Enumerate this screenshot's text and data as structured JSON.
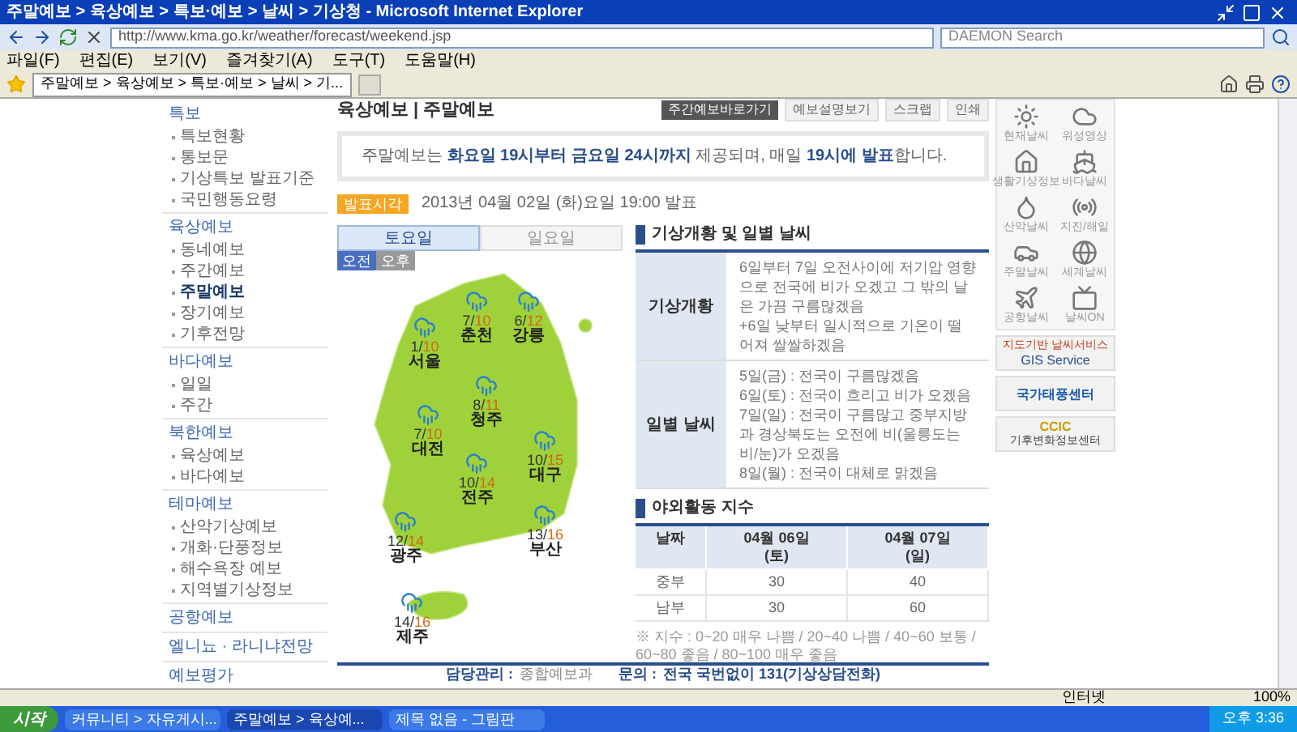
{
  "window": {
    "title": "주말예보 > 육상예보 > 특보·예보 > 날씨 > 기상청 - Microsoft Internet Explorer"
  },
  "address": {
    "url": "http://www.kma.go.kr/weather/forecast/weekend.jsp"
  },
  "search": {
    "placeholder": "DAEMON Search"
  },
  "menu": [
    "파일(F)",
    "편집(E)",
    "보기(V)",
    "즐겨찾기(A)",
    "도구(T)",
    "도움말(H)"
  ],
  "browser_tab": {
    "title": "주말예보 > 육상예보 > 특보·예보 > 날씨 > 기..."
  },
  "sidebar": [
    {
      "title": "특보",
      "items": [
        {
          "label": "특보현황",
          "selected": false
        },
        {
          "label": "통보문",
          "selected": false
        },
        {
          "label": "기상특보 발표기준",
          "selected": false
        },
        {
          "label": "국민행동요령",
          "selected": false
        }
      ]
    },
    {
      "title": "육상예보",
      "items": [
        {
          "label": "동네예보",
          "selected": false
        },
        {
          "label": "주간예보",
          "selected": false
        },
        {
          "label": "주말예보",
          "selected": true
        },
        {
          "label": "장기예보",
          "selected": false
        },
        {
          "label": "기후전망",
          "selected": false
        }
      ]
    },
    {
      "title": "바다예보",
      "items": [
        {
          "label": "일일",
          "selected": false
        },
        {
          "label": "주간",
          "selected": false
        }
      ]
    },
    {
      "title": "북한예보",
      "items": [
        {
          "label": "육상예보",
          "selected": false
        },
        {
          "label": "바다예보",
          "selected": false
        }
      ]
    },
    {
      "title": "테마예보",
      "items": [
        {
          "label": "산악기상예보",
          "selected": false
        },
        {
          "label": "개화·단풍정보",
          "selected": false
        },
        {
          "label": "해수욕장 예보",
          "selected": false
        },
        {
          "label": "지역별기상정보",
          "selected": false
        }
      ]
    },
    {
      "title": "공항예보"
    },
    {
      "title": "엘니뇨 · 라니냐전망"
    },
    {
      "title": "예보평가"
    }
  ],
  "page": {
    "heading": "육상예보 | 주말예보",
    "tools": [
      {
        "kind": "dark",
        "label": "주간예보바로가기"
      },
      {
        "kind": "light",
        "label": "예보설명보기"
      },
      {
        "kind": "light",
        "label": "스크랩"
      },
      {
        "kind": "light",
        "label": "인쇄"
      }
    ],
    "notice": "주말예보는 **화요일 19시부터 금요일 24시까지** 제공되며, 매일 **19시에 발표**합니다.",
    "issued_label": "발표시각",
    "issued": "2013년 04월 02일 (화)요일 19:00 발표"
  },
  "day_tabs": [
    {
      "label": "토요일",
      "selected": true
    },
    {
      "label": "일요일",
      "selected": false
    }
  ],
  "half_tabs": [
    {
      "label": "오전",
      "selected": true
    },
    {
      "label": "오후",
      "selected": false
    }
  ],
  "temp_separator": "/",
  "cities": [
    {
      "name": "서울",
      "low": "1",
      "high": "10"
    },
    {
      "name": "춘천",
      "low": "7",
      "high": "10"
    },
    {
      "name": "강릉",
      "low": "6",
      "high": "12"
    },
    {
      "name": "청주",
      "low": "8",
      "high": "11"
    },
    {
      "name": "대전",
      "low": "7",
      "high": "10"
    },
    {
      "name": "대구",
      "low": "10",
      "high": "15"
    },
    {
      "name": "전주",
      "low": "10",
      "high": "14"
    },
    {
      "name": "광주",
      "low": "12",
      "high": "14"
    },
    {
      "name": "부산",
      "low": "13",
      "high": "16"
    },
    {
      "name": "제주",
      "low": "14",
      "high": "16"
    }
  ],
  "outlook": {
    "title": "기상개황 및 일별 날씨",
    "rows": [
      {
        "label": "기상개황",
        "lines": [
          "6일부터 7일 오전사이에 저기압 영향으로 전국에 비가 오겠고 그 밖의 날은 가끔 구름많겠음",
          "+6일 낮부터 일시적으로 기온이 떨어져 쌀쌀하겠음"
        ]
      },
      {
        "label": "일별 날씨",
        "lines": [
          "5일(금) : 전국이 구름많겠음",
          "6일(토) : 전국이 흐리고 비가 오겠음",
          "7일(일) : 전국이 구름많고 중부지방과 경상북도는 오전에 비(울릉도는 비/눈)가 오겠음",
          "8일(월) : 전국이 대체로 맑겠음"
        ]
      }
    ]
  },
  "outdoor": {
    "title": "야외활동 지수",
    "columns": [
      "날짜",
      "04월 06일\n(토)",
      "04월 07일\n(일)"
    ],
    "rows": [
      [
        "중부",
        "30",
        "40"
      ],
      [
        "남부",
        "30",
        "60"
      ]
    ],
    "note": "※ 지수 : 0~20 매우 나쁨 / 20~40 나쁨 / 40~60 보통 / 60~80 좋음 / 80~100 매우 좋음"
  },
  "footer": {
    "manager": "담당관리 :",
    "manager_value": "종합예보과",
    "contact": "문의 :",
    "contact_value": "전국 국번없이 131(기상상담전화)"
  },
  "quick_links": [
    {
      "kind": "sun",
      "label": "현재날씨"
    },
    {
      "kind": "cloud",
      "label": "위성영상"
    },
    {
      "kind": "house",
      "label": "생활기상정보"
    },
    {
      "kind": "ship",
      "label": "바다날씨"
    },
    {
      "kind": "drop",
      "label": "산악날씨"
    },
    {
      "kind": "radio",
      "label": "지진/해일"
    },
    {
      "kind": "car",
      "label": "주말날씨"
    },
    {
      "kind": "globe",
      "label": "세계날씨"
    },
    {
      "kind": "plane",
      "label": "공항날씨"
    },
    {
      "kind": "tv",
      "label": "날씨ON"
    }
  ],
  "banners": [
    {
      "kind": "gis",
      "lines": [
        "지도기반 날씨서비스",
        "GIS Service"
      ]
    },
    {
      "kind": "typhoon",
      "lines": [
        "국가태풍센터"
      ]
    },
    {
      "kind": "ccic",
      "lines": [
        "CCIC",
        "기후변화정보센터"
      ]
    }
  ],
  "status_bar": {
    "zone": "인터넷",
    "zoom": "100%"
  },
  "taskbar": {
    "start": "시작",
    "tasks": [
      {
        "label": "커뮤니티 > 자유게시...",
        "selected": false
      },
      {
        "label": "주말예보 > 육상예...",
        "selected": true
      },
      {
        "label": "제목 없음 - 그림판",
        "selected": false
      }
    ],
    "clock": "오후 3:36"
  }
}
